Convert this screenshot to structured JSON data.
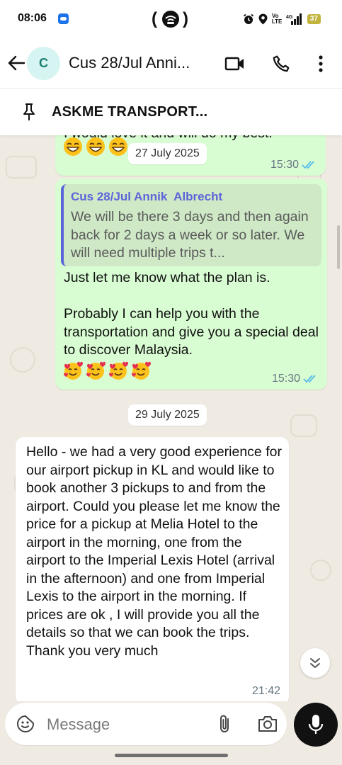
{
  "status_bar": {
    "time": "08:06",
    "signal_text": "Vo LTE",
    "battery": "37"
  },
  "header": {
    "avatar_letter": "C",
    "title": "Cus 28/Jul Anni..."
  },
  "pinned": {
    "text": "ASKME TRANSPORT..."
  },
  "messages": {
    "msg1": {
      "partial_text": "I would love it and will do my best.",
      "floating_date": "27 July 2025",
      "time": "15:30"
    },
    "msg2": {
      "quote_author": "Cus 28/Jul Annik  Albrecht",
      "quote_text": "We will be there 3 days and then again back for 2 days a week or so later. We will need multiple trips t...",
      "text": "Just let me know what the plan is.\n\nProbably I can help you with the transportation and give you a special deal to discover Malaysia.",
      "time": "15:30"
    },
    "date_separator": "29 July 2025",
    "msg3": {
      "text": "Hello - we had a very good experience for our airport pickup in KL and would like to book another 3 pickups to and from the airport. Could you please let me know the price for a pickup at Melia Hotel to the airport in the morning, one from the airport to the Imperial Lexis Hotel (arrival in the afternoon) and one from Imperial Lexis to the airport in the morning. If prices are ok , I will provide you all the details so that we can book the trips. Thank you very much",
      "time": "21:42"
    }
  },
  "input": {
    "placeholder": "Message"
  },
  "colors": {
    "outgoing_bubble": "#d9fdd3",
    "incoming_bubble": "#ffffff",
    "chat_background": "#efeae2",
    "read_ticks": "#53bdeb",
    "quote_accent": "#5b64d9"
  },
  "icons": {
    "back": "arrow-left-icon",
    "video": "video-call-icon",
    "call": "phone-icon",
    "menu": "more-vert-icon",
    "pin": "pin-icon",
    "emoji": "emoji-sticker-icon",
    "attach": "paperclip-icon",
    "camera": "camera-icon",
    "mic": "mic-icon",
    "scroll": "double-chevron-down-icon"
  }
}
